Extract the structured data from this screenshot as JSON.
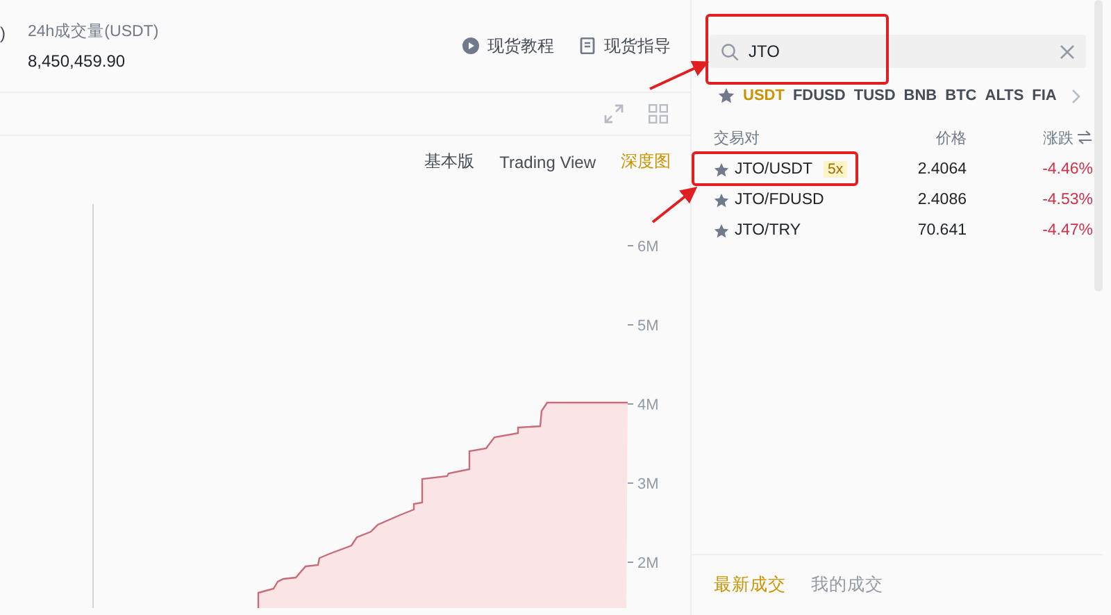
{
  "header": {
    "cut_text": ")",
    "stat_label": "24h成交量(USDT)",
    "stat_value": "8,450,459.90",
    "links": [
      {
        "kind": "play",
        "label": "现货教程"
      },
      {
        "kind": "doc",
        "label": "现货指导"
      }
    ]
  },
  "chart_views": [
    {
      "label": "基本版",
      "selected": false
    },
    {
      "label": "Trading View",
      "selected": false
    },
    {
      "label": "深度图",
      "selected": true
    }
  ],
  "depth_axis_labels": [
    "6M",
    "5M",
    "4M",
    "3M",
    "2M"
  ],
  "market": {
    "search": {
      "value": "JTO"
    },
    "quote_tabs": [
      {
        "label": "USDT",
        "selected": true
      },
      {
        "label": "FDUSD",
        "selected": false
      },
      {
        "label": "TUSD",
        "selected": false
      },
      {
        "label": "BNB",
        "selected": false
      },
      {
        "label": "BTC",
        "selected": false
      },
      {
        "label": "ALTS",
        "selected": false
      },
      {
        "label": "FIA",
        "selected": false
      }
    ],
    "columns": [
      "交易对",
      "价格",
      "涨跌"
    ],
    "rows": [
      {
        "pair": "JTO/USDT",
        "leverage": "5x",
        "price": "2.4064",
        "change": "-4.46%"
      },
      {
        "pair": "JTO/FDUSD",
        "price": "2.4086",
        "change": "-4.53%"
      },
      {
        "pair": "JTO/TRY",
        "price": "70.641",
        "change": "-4.47%"
      }
    ]
  },
  "trades_tabs": [
    {
      "label": "最新成交",
      "selected": true
    },
    {
      "label": "我的成交",
      "selected": false
    }
  ],
  "annotations": [
    {
      "kind": "box"
    },
    {
      "kind": "box"
    },
    {
      "kind": "arrow"
    },
    {
      "kind": "arrow"
    }
  ]
}
